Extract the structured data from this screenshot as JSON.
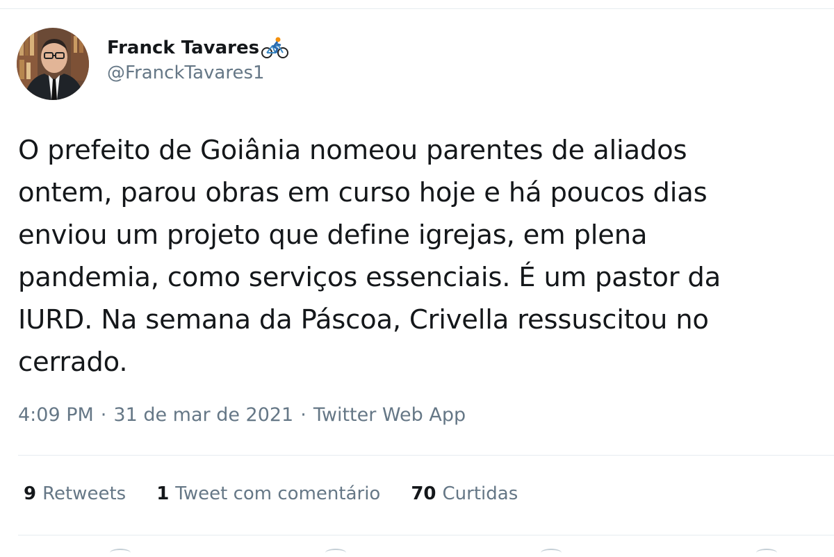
{
  "tweet": {
    "author": {
      "display_name": "Franck Tavares",
      "handle": "@FranckTavares1",
      "name_emoji": "bicyclist-icon"
    },
    "text": "O prefeito de Goiânia nomeou parentes de aliados\nontem, parou obras em curso hoje e há poucos dias\nenviou um projeto que define igrejas, em plena\npandemia, como serviços essenciais. É um pastor da\nIURD. Na semana da Páscoa, Crivella ressuscitou no\ncerrado.",
    "time": "4:09 PM",
    "date": "31 de mar de 2021",
    "separator": "·",
    "source": "Twitter Web App"
  },
  "stats": {
    "retweets_count": "9",
    "retweets_label": "Retweets",
    "quotes_count": "1",
    "quotes_label": "Tweet com comentário",
    "likes_count": "70",
    "likes_label": "Curtidas"
  },
  "colors": {
    "text_primary": "#14171a",
    "text_secondary": "#657786",
    "divider": "#e6ecf0"
  },
  "icons": {
    "action_bar": [
      "reply-icon",
      "retweet-icon",
      "like-icon",
      "share-icon"
    ]
  }
}
